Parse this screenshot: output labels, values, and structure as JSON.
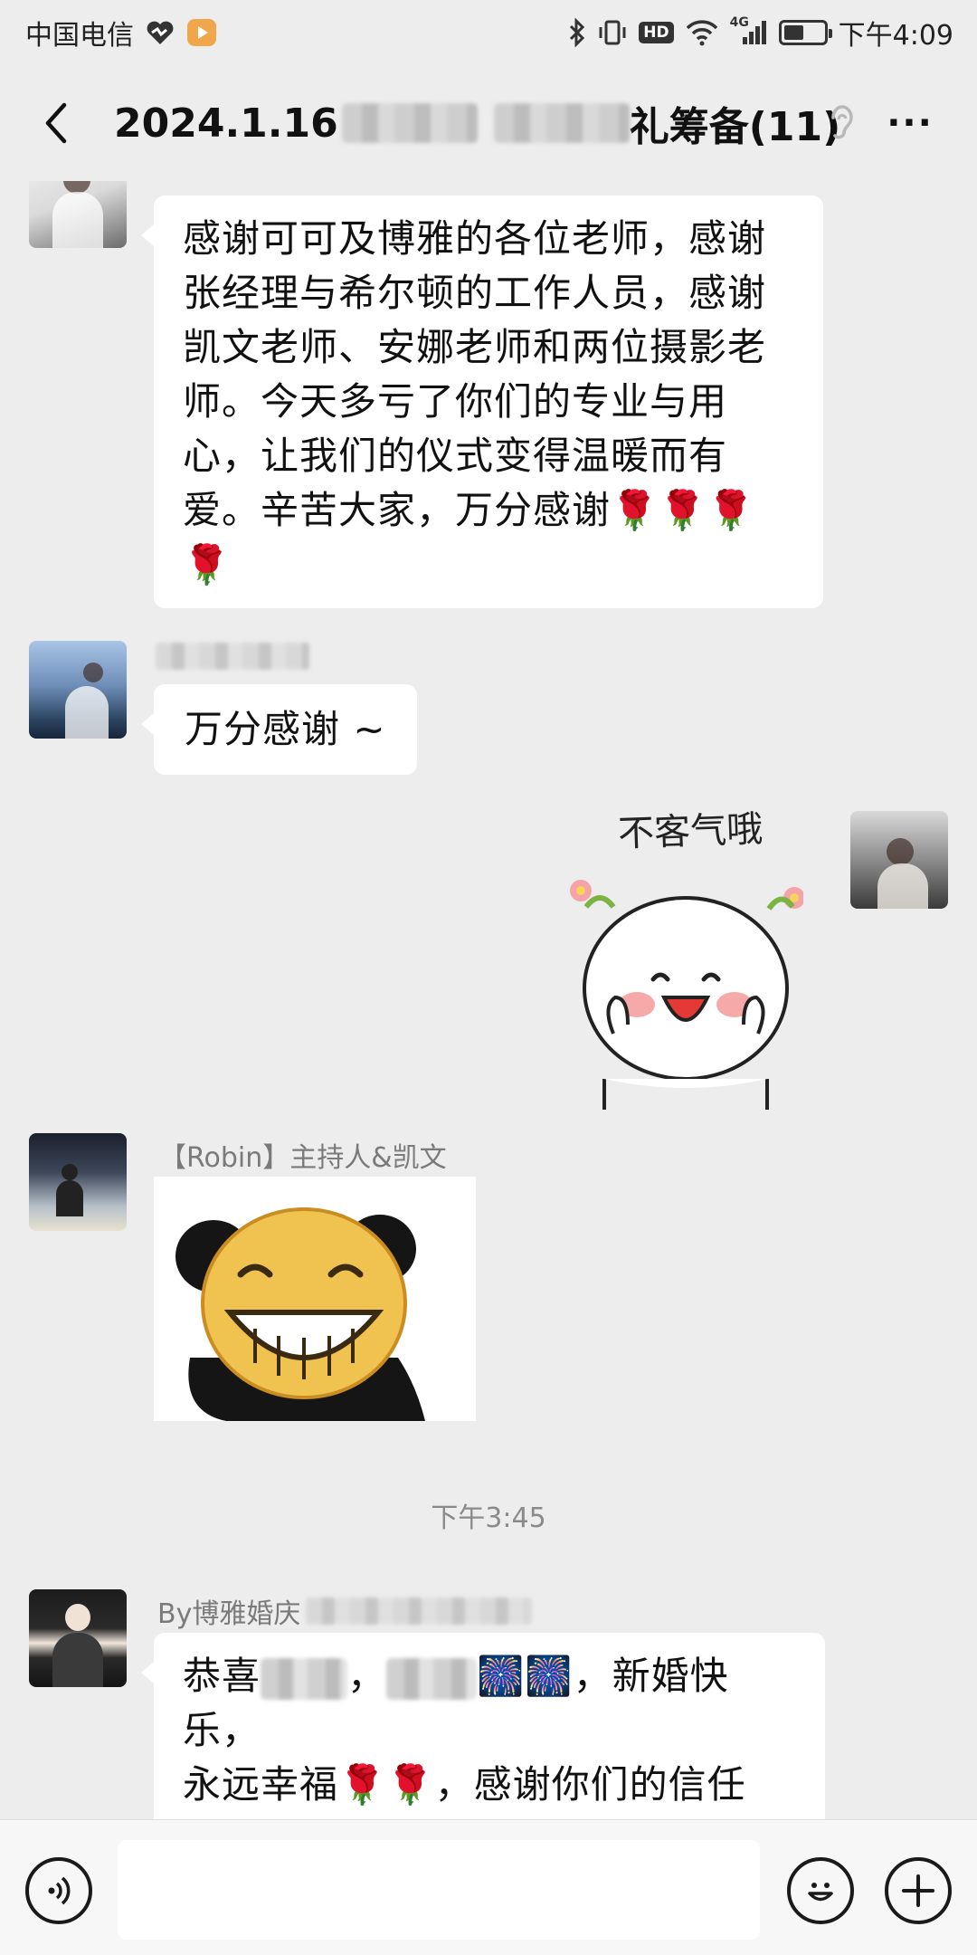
{
  "status_bar": {
    "carrier": "中国电信",
    "signal_label": "4G",
    "hd_label": "HD",
    "time": "下午4:09",
    "battery_level": 0.5
  },
  "header": {
    "title_prefix": "2024.1.16",
    "title_suffix": "礼筹备(11)",
    "back_icon": "chevron-left-icon",
    "ear_icon": "ear-icon",
    "more_label": "···"
  },
  "messages": [
    {
      "type": "text",
      "text_lines": [
        "感谢可可及博雅的各位老师，感谢",
        "张经理与希尔顿的工作人员，感谢",
        "凯文老师、安娜老师和两位摄影老",
        "师。今天多亏了你们的专业与用",
        "心，让我们的仪式变得温暖而有",
        "爱。辛苦大家，万分感谢🌹🌹🌹",
        "🌹"
      ]
    },
    {
      "type": "text",
      "text": "万分感谢 ~"
    },
    {
      "type": "sticker",
      "caption": "不客气哦"
    },
    {
      "type": "sticker",
      "sender": "【Robin】主持人&凯文"
    },
    {
      "type": "timestamp",
      "text": "下午3:45"
    },
    {
      "type": "text",
      "sender": "By博雅婚庆",
      "line1_prefix": "恭喜",
      "line1_fireworks": "🎆🎆",
      "line1_suffix": "，新婚快乐，",
      "line2": "永远幸福🌹🌹，感谢你们的信任",
      "line3": "🙏🙏"
    }
  ],
  "input_bar": {
    "voice_icon": "voice-icon",
    "emoji_icon": "emoji-icon",
    "plus_icon": "plus-icon"
  }
}
